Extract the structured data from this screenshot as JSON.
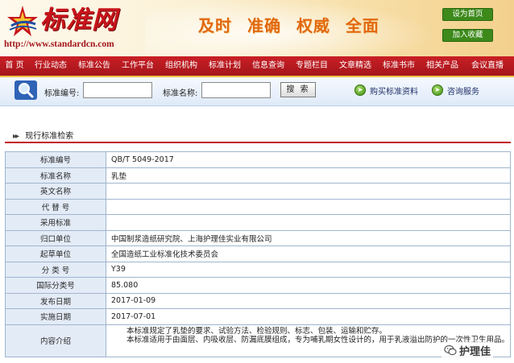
{
  "header": {
    "logo_text": "标准网",
    "url_text": "http://www.standardcn.com",
    "slogan": [
      "及时",
      "准确",
      "权威",
      "全面"
    ],
    "set_home": "设为首页",
    "add_favorite": "加入收藏"
  },
  "nav": {
    "items": [
      "首 页",
      "行业动态",
      "标准公告",
      "工作平台",
      "组织机构",
      "标准计划",
      "信息查询",
      "专题栏目",
      "文章精选",
      "标准书市",
      "相关产品",
      "会议直播"
    ]
  },
  "search": {
    "code_label": "标准编号:",
    "code_value": "",
    "name_label": "标准名称:",
    "name_value": "",
    "button": "搜 索",
    "buy_link": "购买标准资料",
    "consult_link": "咨询服务"
  },
  "section": {
    "title": "现行标准检索"
  },
  "detail": {
    "rows": [
      {
        "label": "标准编号",
        "value": "QB/T 5049-2017"
      },
      {
        "label": "标准名称",
        "value": "乳垫"
      },
      {
        "label": "英文名称",
        "value": ""
      },
      {
        "label": "代 替 号",
        "value": ""
      },
      {
        "label": "采用标准",
        "value": ""
      },
      {
        "label": "归口单位",
        "value": "中国制浆造纸研究院、上海护理佳实业有限公司"
      },
      {
        "label": "起草单位",
        "value": "全国造纸工业标准化技术委员会"
      },
      {
        "label": "分 类 号",
        "value": "Y39"
      },
      {
        "label": "国际分类号",
        "value": "85.080"
      },
      {
        "label": "发布日期",
        "value": "2017-01-09"
      },
      {
        "label": "实施日期",
        "value": "2017-07-01"
      }
    ],
    "intro_label": "内容介绍",
    "intro_lines": [
      "本标准规定了乳垫的要求、试验方法、检验规则、标志、包装、运输和贮存。",
      "本标准适用于由面层、内吸收层、防漏底膜组成，专为哺乳期女性设计的，用于乳液溢出防护的一次性卫生用品。"
    ]
  },
  "watermark": {
    "text": "护理佳"
  },
  "colors": {
    "brand_red": "#c8141b",
    "nav_red": "#b81a20",
    "slogan_orange": "#e2680d",
    "button_green": "#3d8a1b",
    "label_bg": "#e3ebf6"
  }
}
